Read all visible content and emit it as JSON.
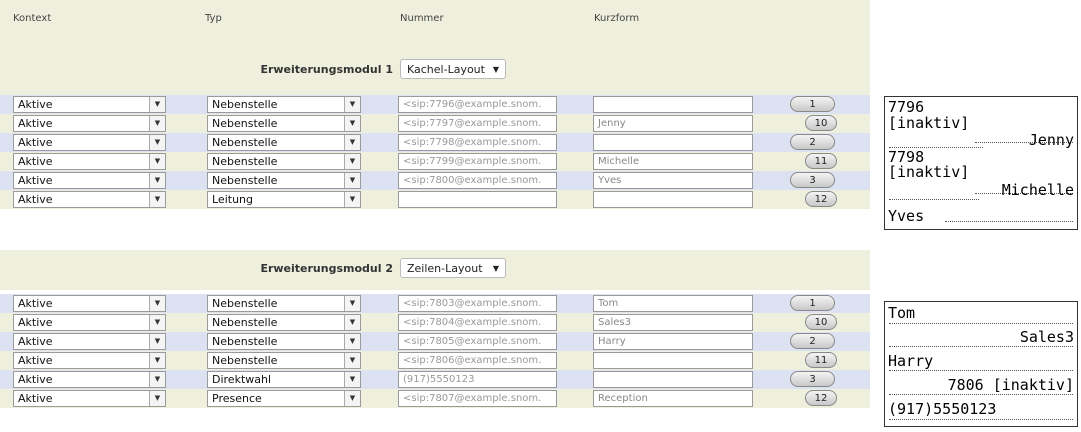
{
  "columns": {
    "kontext": "Kontext",
    "typ": "Typ",
    "nummer": "Nummer",
    "kurzform": "Kurzform"
  },
  "module1": {
    "label": "Erweiterungsmodul 1",
    "layout": "Kachel-Layout",
    "rows": [
      {
        "kontext": "Aktive",
        "typ": "Nebenstelle",
        "nummer": "<sip:7796@example.snom.",
        "kurzform": "",
        "key": "1"
      },
      {
        "kontext": "Aktive",
        "typ": "Nebenstelle",
        "nummer": "<sip:7797@example.snom.",
        "kurzform": "Jenny",
        "key": "10"
      },
      {
        "kontext": "Aktive",
        "typ": "Nebenstelle",
        "nummer": "<sip:7798@example.snom.",
        "kurzform": "",
        "key": "2"
      },
      {
        "kontext": "Aktive",
        "typ": "Nebenstelle",
        "nummer": "<sip:7799@example.snom.",
        "kurzform": "Michelle",
        "key": "11"
      },
      {
        "kontext": "Aktive",
        "typ": "Nebenstelle",
        "nummer": "<sip:7800@example.snom.",
        "kurzform": "Yves",
        "key": "3"
      },
      {
        "kontext": "Aktive",
        "typ": "Leitung",
        "nummer": "",
        "kurzform": "",
        "key": "12"
      }
    ],
    "display": {
      "l1": "7796",
      "l2": "[inaktiv]",
      "r1": "Jenny",
      "l3": "7798",
      "l4": "[inaktiv]",
      "r2": "Michelle",
      "l5": "Yves"
    }
  },
  "module2": {
    "label": "Erweiterungsmodul 2",
    "layout": "Zeilen-Layout",
    "rows": [
      {
        "kontext": "Aktive",
        "typ": "Nebenstelle",
        "nummer": "<sip:7803@example.snom.",
        "kurzform": "Tom",
        "key": "1"
      },
      {
        "kontext": "Aktive",
        "typ": "Nebenstelle",
        "nummer": "<sip:7804@example.snom.",
        "kurzform": "Sales3",
        "key": "10"
      },
      {
        "kontext": "Aktive",
        "typ": "Nebenstelle",
        "nummer": "<sip:7805@example.snom.",
        "kurzform": "Harry",
        "key": "2"
      },
      {
        "kontext": "Aktive",
        "typ": "Nebenstelle",
        "nummer": "<sip:7806@example.snom.",
        "kurzform": "",
        "key": "11"
      },
      {
        "kontext": "Aktive",
        "typ": "Direktwahl",
        "nummer": "(917)5550123",
        "kurzform": "",
        "key": "3"
      },
      {
        "kontext": "Aktive",
        "typ": "Presence",
        "nummer": "<sip:7807@example.snom.",
        "kurzform": "Reception",
        "key": "12"
      }
    ],
    "display": {
      "d1": "Tom",
      "d2": "Sales3",
      "d3": "Harry",
      "d4": "7806 [inaktiv]",
      "d5": "(917)5550123"
    }
  }
}
